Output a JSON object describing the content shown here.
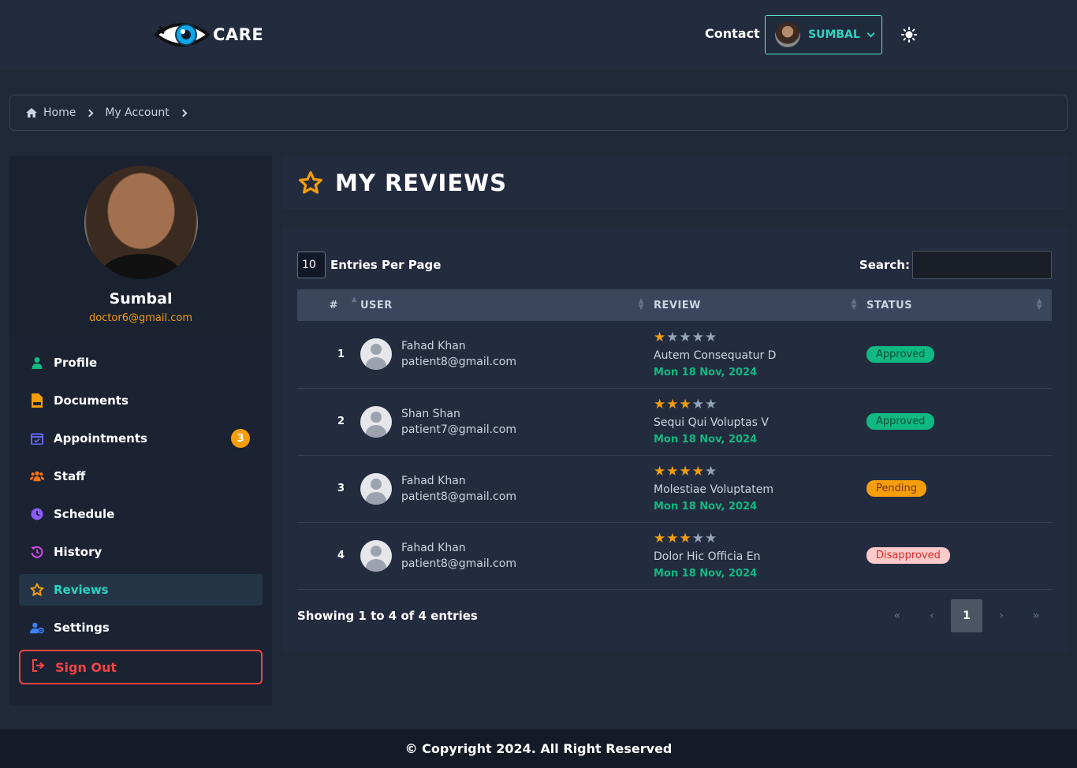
{
  "header": {
    "brand": "CARE",
    "contact": "Contact",
    "user_name": "SUMBAL"
  },
  "breadcrumb": {
    "home": "Home",
    "account": "My Account"
  },
  "sidebar": {
    "name": "Sumbal",
    "email": "doctor6@gmail.com",
    "items": [
      {
        "label": "Profile",
        "icon": "user-icon",
        "color": "#10b981"
      },
      {
        "label": "Documents",
        "icon": "pdf-icon",
        "color": "#f59e0b"
      },
      {
        "label": "Appointments",
        "icon": "calendar-icon",
        "color": "#6366f1",
        "badge": "3"
      },
      {
        "label": "Staff",
        "icon": "users-icon",
        "color": "#f97316"
      },
      {
        "label": "Schedule",
        "icon": "clock-icon",
        "color": "#8b5cf6"
      },
      {
        "label": "History",
        "icon": "history-icon",
        "color": "#d946ef"
      },
      {
        "label": "Reviews",
        "icon": "star-icon",
        "color": "#f59e0b",
        "active": true
      },
      {
        "label": "Settings",
        "icon": "user-gear-icon",
        "color": "#3b82f6"
      }
    ],
    "signout": "Sign Out"
  },
  "page": {
    "title": "MY REVIEWS"
  },
  "table": {
    "per_page": "10",
    "per_page_label": "Entries Per Page",
    "search_label": "Search:",
    "search_value": "",
    "columns": [
      "#",
      "USER",
      "REVIEW",
      "STATUS"
    ],
    "rows": [
      {
        "num": "1",
        "name": "Fahad Khan",
        "email": "patient8@gmail.com",
        "stars": 1,
        "review": "Autem Consequatur D",
        "date": "Mon 18 Nov, 2024",
        "status": "Approved",
        "status_type": "approved"
      },
      {
        "num": "2",
        "name": "Shan Shan",
        "email": "patient7@gmail.com",
        "stars": 3,
        "review": "Sequi Qui Voluptas V",
        "date": "Mon 18 Nov, 2024",
        "status": "Approved",
        "status_type": "approved"
      },
      {
        "num": "3",
        "name": "Fahad Khan",
        "email": "patient8@gmail.com",
        "stars": 4,
        "review": "Molestiae Voluptatem",
        "date": "Mon 18 Nov, 2024",
        "status": "Pending",
        "status_type": "pending"
      },
      {
        "num": "4",
        "name": "Fahad Khan",
        "email": "patient8@gmail.com",
        "stars": 3,
        "review": "Dolor Hic Officia En",
        "date": "Mon 18 Nov, 2024",
        "status": "Disapproved",
        "status_type": "disapproved"
      }
    ],
    "showing": "Showing 1 to 4 of 4 entries",
    "pager": {
      "first": "«",
      "prev": "‹",
      "current": "1",
      "next": "›",
      "last": "»"
    }
  },
  "footer": "© Copyright 2024. All Right Reserved"
}
